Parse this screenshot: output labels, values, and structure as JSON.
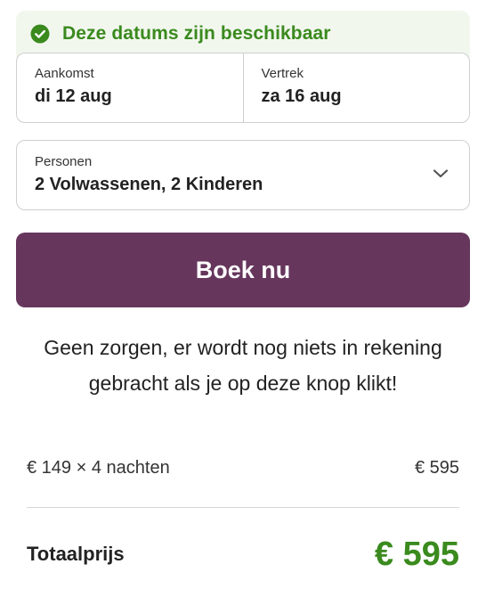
{
  "availability": {
    "text": "Deze datums zijn beschikbaar",
    "icon": "check-circle-icon",
    "color": "#3a8a1e"
  },
  "arrival": {
    "label": "Aankomst",
    "value": "di 12 aug"
  },
  "departure": {
    "label": "Vertrek",
    "value": "za 16 aug"
  },
  "persons": {
    "label": "Personen",
    "value": "2 Volwassenen, 2 Kinderen",
    "icon": "chevron-down-icon"
  },
  "book_button": {
    "label": "Boek nu",
    "color": "#66365c"
  },
  "reassurance": "Geen zorgen, er wordt nog niets in rekening gebracht als je op deze knop klikt!",
  "price_breakdown": {
    "description": "€ 149 × 4 nachten",
    "amount": "€ 595"
  },
  "total": {
    "label": "Totaalprijs",
    "value": "€ 595",
    "color": "#3a8a1e"
  }
}
